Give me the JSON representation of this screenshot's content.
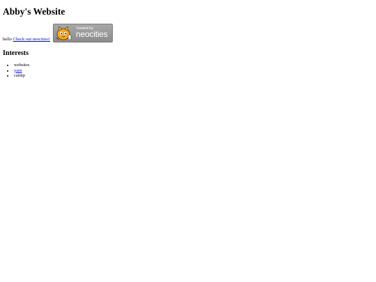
{
  "site": {
    "title": "Abby's Website",
    "greeting": "hello",
    "link_label": "Check out neocities!",
    "badge": {
      "hosted_text": "hosted by",
      "brand_text": "neocities"
    }
  },
  "interests": {
    "heading": "Interests",
    "items": [
      {
        "label": "websites",
        "is_link": false
      },
      {
        "label": "yarn",
        "is_link": true
      },
      {
        "label": "catnip",
        "is_link": false
      }
    ]
  },
  "colors": {
    "link": "#0000ee",
    "badge_bg": "#9a9a9a",
    "text": "#000000"
  }
}
